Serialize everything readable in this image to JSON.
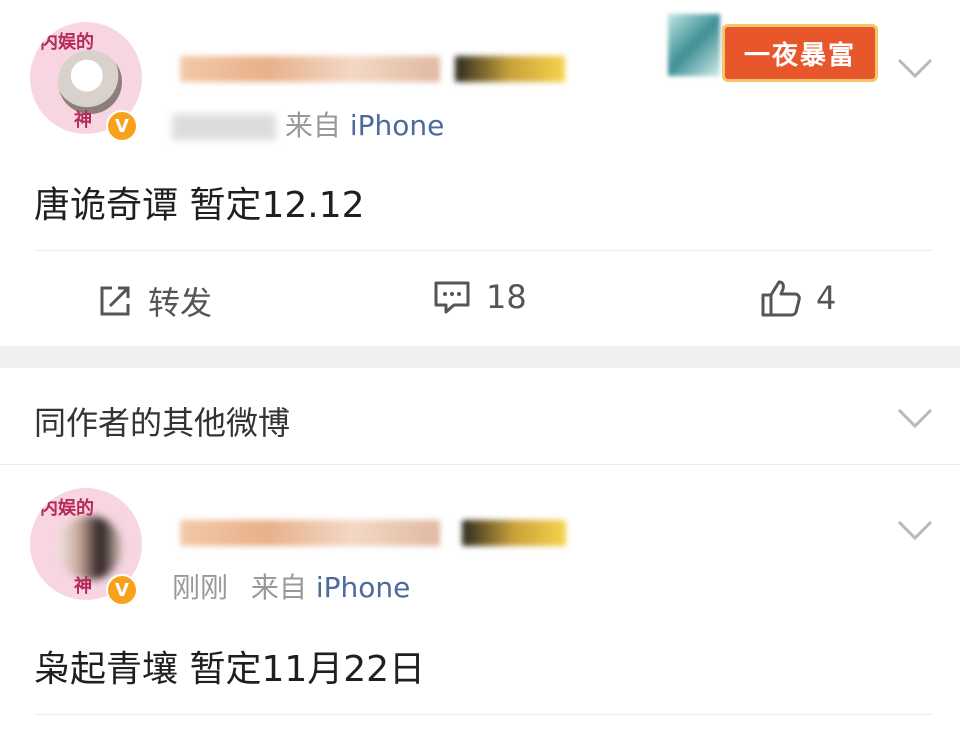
{
  "post1": {
    "avatar_tag_top": "内娱的",
    "avatar_tag_bottom": "神",
    "verified_mark": "V",
    "source_prefix": "来自",
    "source": "iPhone",
    "badge_text": "一夜暴富",
    "content": "唐诡奇谭 暂定12.12",
    "actions": {
      "repost": "转发",
      "comments": "18",
      "likes": "4"
    }
  },
  "section": {
    "title": "同作者的其他微博"
  },
  "post2": {
    "avatar_tag_top": "内娱的",
    "avatar_tag_bottom": "神",
    "verified_mark": "V",
    "time": "刚刚",
    "source_prefix": "来自",
    "source": "iPhone",
    "content": "枭起青壤 暂定11月22日"
  },
  "colors": {
    "link": "#4a6b9c",
    "verified": "#f7a21a",
    "badge": "#e8562b",
    "band": "#f0f0f0"
  }
}
